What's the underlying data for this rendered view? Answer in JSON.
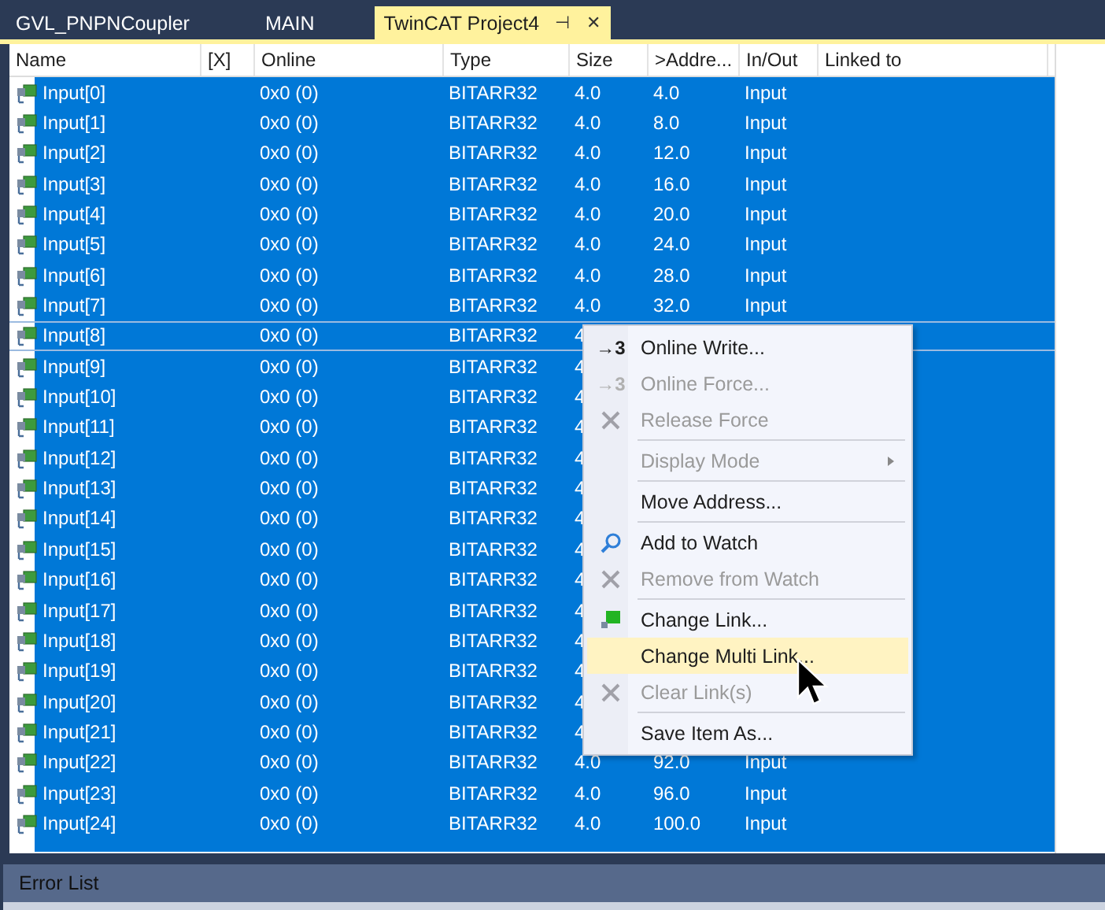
{
  "tabs": [
    {
      "label": "GVL_PNPNCoupler",
      "selected": false
    },
    {
      "label": "MAIN",
      "selected": false
    },
    {
      "label": "TwinCAT Project4",
      "selected": true,
      "pin": "⊣",
      "close": "✕"
    }
  ],
  "table": {
    "columns": [
      "Name",
      "[X]",
      "Online",
      "Type",
      "Size",
      ">Addre...",
      "In/Out",
      "Linked to"
    ],
    "rows": [
      {
        "name": "Input[0]",
        "online": "0x0 (0)",
        "type": "BITARR32",
        "size": "4.0",
        "address": "4.0",
        "in_out": "Input",
        "selected": true,
        "focused": false
      },
      {
        "name": "Input[1]",
        "online": "0x0 (0)",
        "type": "BITARR32",
        "size": "4.0",
        "address": "8.0",
        "in_out": "Input",
        "selected": true,
        "focused": false
      },
      {
        "name": "Input[2]",
        "online": "0x0 (0)",
        "type": "BITARR32",
        "size": "4.0",
        "address": "12.0",
        "in_out": "Input",
        "selected": true,
        "focused": false
      },
      {
        "name": "Input[3]",
        "online": "0x0 (0)",
        "type": "BITARR32",
        "size": "4.0",
        "address": "16.0",
        "in_out": "Input",
        "selected": true,
        "focused": false
      },
      {
        "name": "Input[4]",
        "online": "0x0 (0)",
        "type": "BITARR32",
        "size": "4.0",
        "address": "20.0",
        "in_out": "Input",
        "selected": true,
        "focused": false
      },
      {
        "name": "Input[5]",
        "online": "0x0 (0)",
        "type": "BITARR32",
        "size": "4.0",
        "address": "24.0",
        "in_out": "Input",
        "selected": true,
        "focused": false
      },
      {
        "name": "Input[6]",
        "online": "0x0 (0)",
        "type": "BITARR32",
        "size": "4.0",
        "address": "28.0",
        "in_out": "Input",
        "selected": true,
        "focused": false
      },
      {
        "name": "Input[7]",
        "online": "0x0 (0)",
        "type": "BITARR32",
        "size": "4.0",
        "address": "32.0",
        "in_out": "Input",
        "selected": true,
        "focused": false
      },
      {
        "name": "Input[8]",
        "online": "0x0 (0)",
        "type": "BITARR32",
        "size": "4",
        "selected": true,
        "focused": true
      },
      {
        "name": "Input[9]",
        "online": "0x0 (0)",
        "type": "BITARR32",
        "size": "4",
        "selected": true,
        "focused": false
      },
      {
        "name": "Input[10]",
        "online": "0x0 (0)",
        "type": "BITARR32",
        "size": "4",
        "selected": true,
        "focused": false
      },
      {
        "name": "Input[11]",
        "online": "0x0 (0)",
        "type": "BITARR32",
        "size": "4",
        "selected": true,
        "focused": false
      },
      {
        "name": "Input[12]",
        "online": "0x0 (0)",
        "type": "BITARR32",
        "size": "4",
        "selected": true,
        "focused": false
      },
      {
        "name": "Input[13]",
        "online": "0x0 (0)",
        "type": "BITARR32",
        "size": "4",
        "selected": true,
        "focused": false
      },
      {
        "name": "Input[14]",
        "online": "0x0 (0)",
        "type": "BITARR32",
        "size": "4",
        "selected": true,
        "focused": false
      },
      {
        "name": "Input[15]",
        "online": "0x0 (0)",
        "type": "BITARR32",
        "size": "4",
        "selected": true,
        "focused": false
      },
      {
        "name": "Input[16]",
        "online": "0x0 (0)",
        "type": "BITARR32",
        "size": "4",
        "selected": true,
        "focused": false
      },
      {
        "name": "Input[17]",
        "online": "0x0 (0)",
        "type": "BITARR32",
        "size": "4",
        "selected": true,
        "focused": false
      },
      {
        "name": "Input[18]",
        "online": "0x0 (0)",
        "type": "BITARR32",
        "size": "4",
        "selected": true,
        "focused": false
      },
      {
        "name": "Input[19]",
        "online": "0x0 (0)",
        "type": "BITARR32",
        "size": "4",
        "selected": true,
        "focused": false
      },
      {
        "name": "Input[20]",
        "online": "0x0 (0)",
        "type": "BITARR32",
        "size": "4",
        "selected": true,
        "focused": false
      },
      {
        "name": "Input[21]",
        "online": "0x0 (0)",
        "type": "BITARR32",
        "size": "4",
        "selected": true,
        "focused": false
      },
      {
        "name": "Input[22]",
        "online": "0x0 (0)",
        "type": "BITARR32",
        "size": "4.0",
        "address": "92.0",
        "in_out": "Input",
        "selected": true,
        "focused": false
      },
      {
        "name": "Input[23]",
        "online": "0x0 (0)",
        "type": "BITARR32",
        "size": "4.0",
        "address": "96.0",
        "in_out": "Input",
        "selected": true,
        "focused": false
      },
      {
        "name": "Input[24]",
        "online": "0x0 (0)",
        "type": "BITARR32",
        "size": "4.0",
        "address": "100.0",
        "in_out": "Input",
        "selected": true,
        "focused": false
      },
      {
        "selected": true,
        "focused": false
      }
    ]
  },
  "context_menu": {
    "items": [
      {
        "kind": "item",
        "label": "Online Write...",
        "disabled": false,
        "highlighted": false,
        "glyph": "→3"
      },
      {
        "kind": "item",
        "label": "Online Force...",
        "disabled": true,
        "highlighted": false,
        "glyph": "→3"
      },
      {
        "kind": "item",
        "label": "Release Force",
        "disabled": true,
        "highlighted": false
      },
      {
        "kind": "separator"
      },
      {
        "kind": "item",
        "label": "Display Mode",
        "disabled": true,
        "highlighted": false,
        "submenu": true
      },
      {
        "kind": "separator"
      },
      {
        "kind": "item",
        "label": "Move Address...",
        "disabled": false,
        "highlighted": false
      },
      {
        "kind": "separator"
      },
      {
        "kind": "item",
        "label": "Add to Watch",
        "disabled": false,
        "highlighted": false
      },
      {
        "kind": "item",
        "label": "Remove from Watch",
        "disabled": true,
        "highlighted": false
      },
      {
        "kind": "separator"
      },
      {
        "kind": "item",
        "label": "Change Link...",
        "disabled": false,
        "highlighted": false
      },
      {
        "kind": "item",
        "label": "Change Multi Link...",
        "disabled": false,
        "highlighted": true
      },
      {
        "kind": "item",
        "label": "Clear Link(s)",
        "disabled": true,
        "highlighted": false
      },
      {
        "kind": "separator"
      },
      {
        "kind": "item",
        "label": "Save Item As...",
        "disabled": false,
        "highlighted": false
      }
    ]
  },
  "bottom_panel": {
    "title": "Error List"
  }
}
